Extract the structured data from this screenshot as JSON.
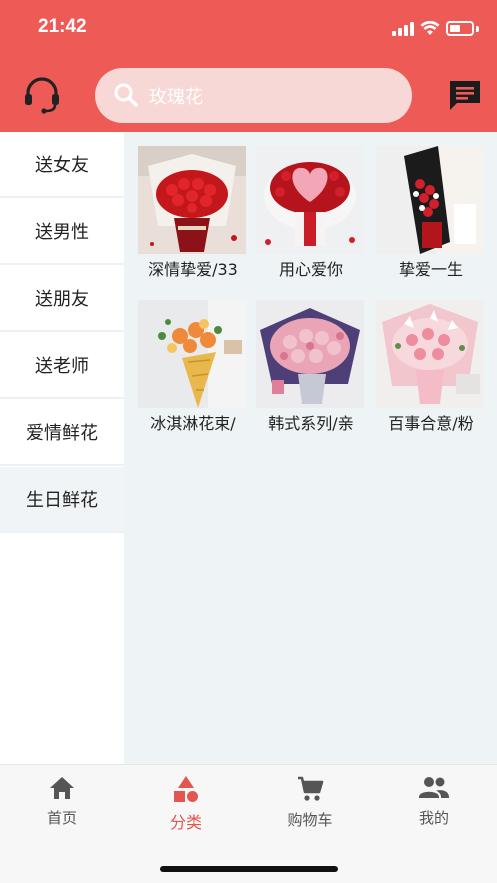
{
  "status_bar": {
    "time": "21:42"
  },
  "header": {
    "search_placeholder": "玫瑰花",
    "accent_color": "#ee5b56"
  },
  "sidebar": {
    "items": [
      {
        "label": "送女友",
        "active": false
      },
      {
        "label": "送男性",
        "active": false
      },
      {
        "label": "送朋友",
        "active": false
      },
      {
        "label": "送老师",
        "active": false
      },
      {
        "label": "爱情鲜花",
        "active": false
      },
      {
        "label": "生日鲜花",
        "active": true
      }
    ]
  },
  "products": [
    {
      "name": "深情挚爱/33",
      "icon": "red-rose-bouquet"
    },
    {
      "name": "用心爱你",
      "icon": "heart-rose-bouquet"
    },
    {
      "name": "挚爱一生",
      "icon": "long-box-bouquet"
    },
    {
      "name": "冰淇淋花束/",
      "icon": "ice-cream-bouquet"
    },
    {
      "name": "韩式系列/亲",
      "icon": "korean-style-bouquet"
    },
    {
      "name": "百事合意/粉",
      "icon": "lily-bouquet"
    }
  ],
  "tabbar": {
    "items": [
      {
        "label": "首页",
        "icon": "home-icon",
        "active": false
      },
      {
        "label": "分类",
        "icon": "category-icon",
        "active": true
      },
      {
        "label": "购物车",
        "icon": "cart-icon",
        "active": false
      },
      {
        "label": "我的",
        "icon": "people-icon",
        "active": false
      }
    ]
  }
}
